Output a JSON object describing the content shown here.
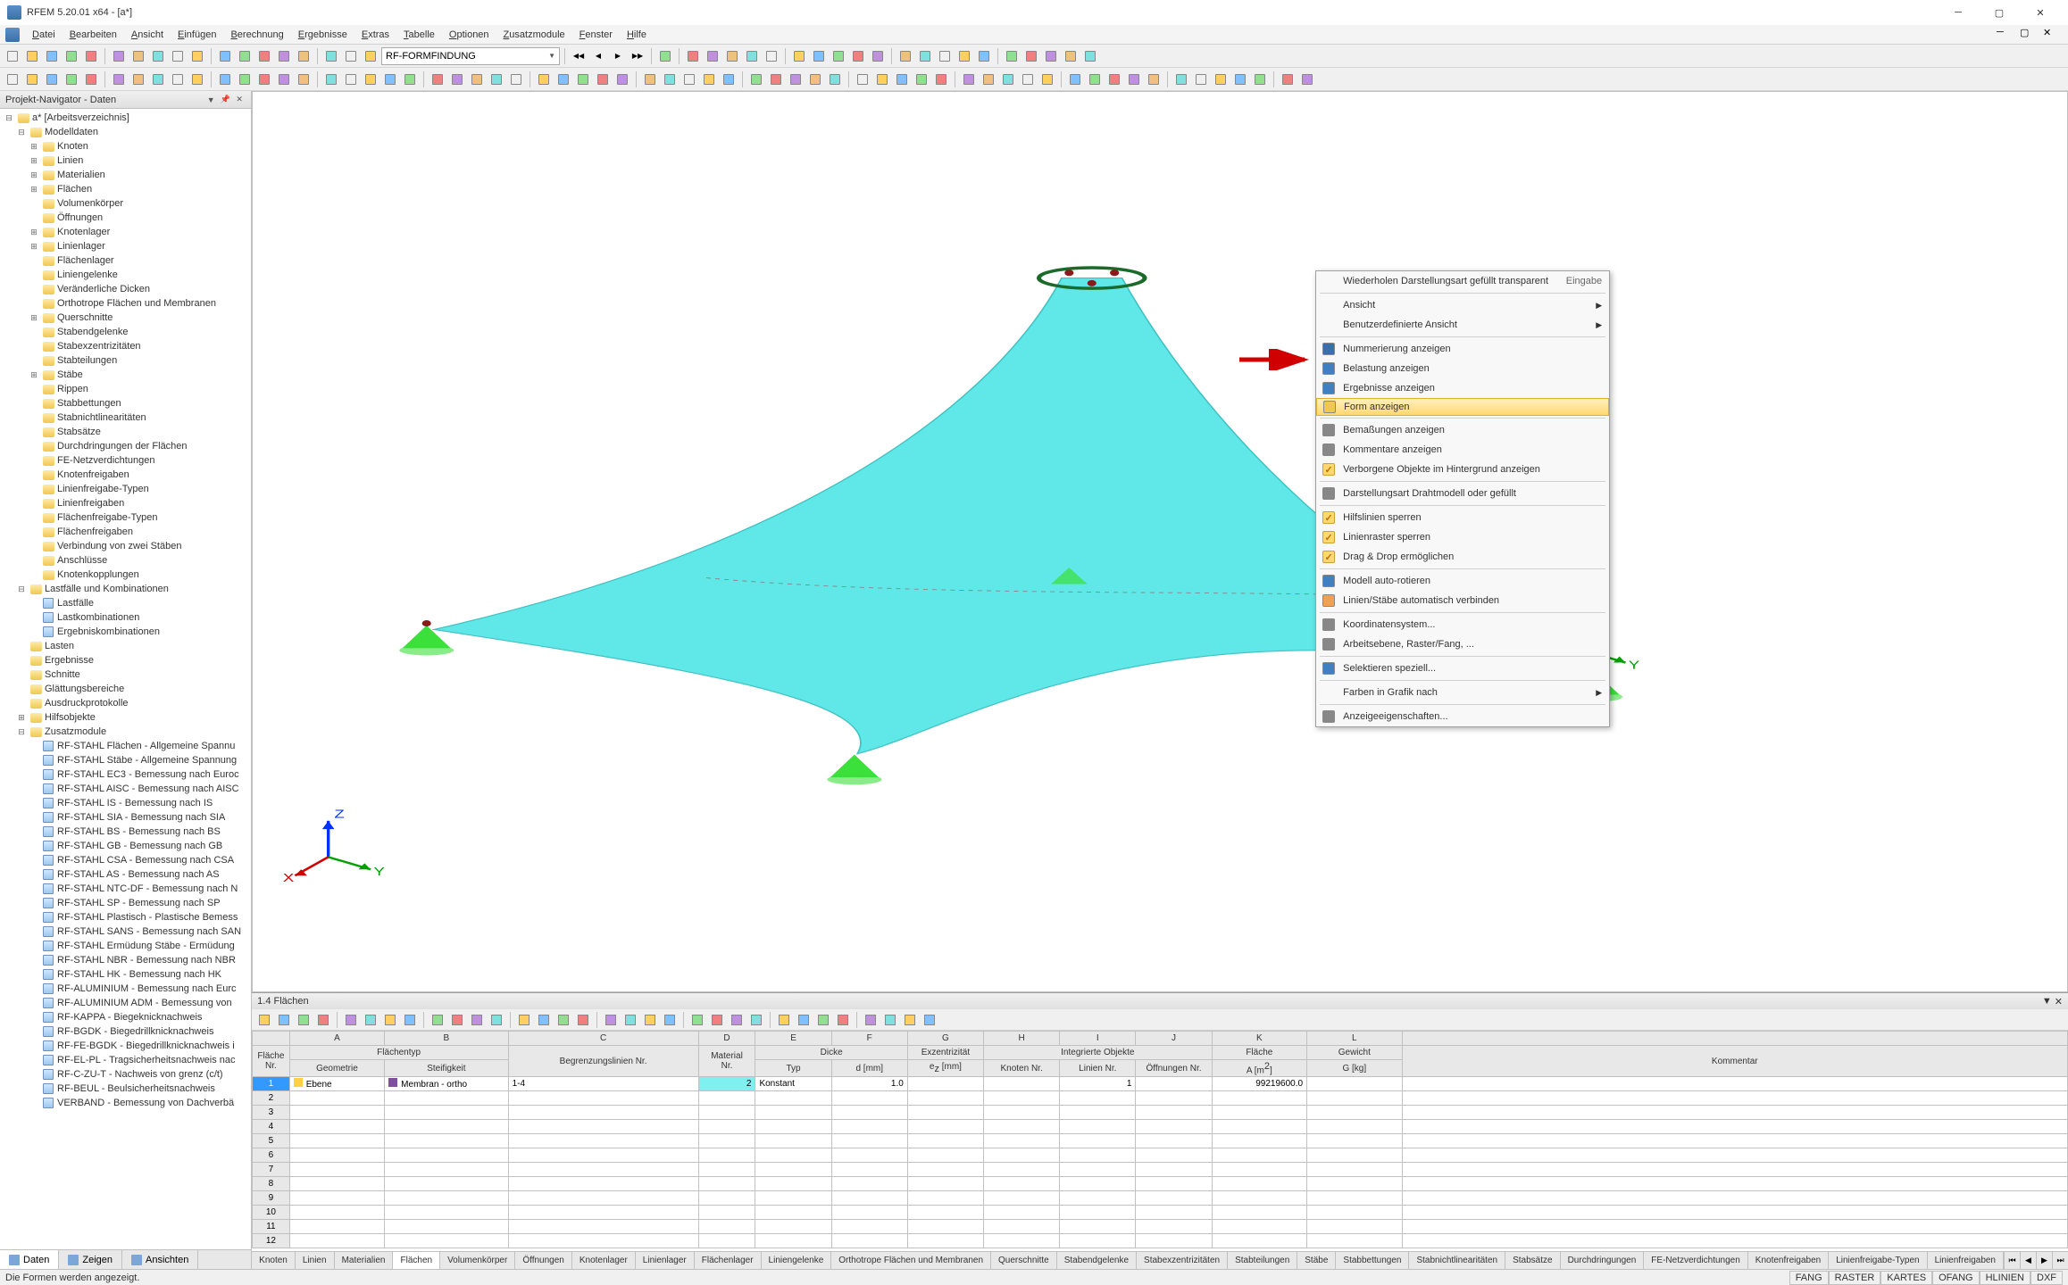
{
  "app": {
    "title": "RFEM 5.20.01 x64 - [a*]"
  },
  "menu": [
    "Datei",
    "Bearbeiten",
    "Ansicht",
    "Einfügen",
    "Berechnung",
    "Ergebnisse",
    "Extras",
    "Tabelle",
    "Optionen",
    "Zusatzmodule",
    "Fenster",
    "Hilfe"
  ],
  "toolbar_combo": "RF-FORMFINDUNG",
  "navigator": {
    "title": "Projekt-Navigator - Daten",
    "root": "a* [Arbeitsverzeichnis]",
    "tabs": [
      "Daten",
      "Zeigen",
      "Ansichten"
    ],
    "modelldaten": {
      "label": "Modelldaten",
      "children": [
        "Knoten",
        "Linien",
        "Materialien",
        "Flächen",
        "Volumenkörper",
        "Öffnungen",
        "Knotenlager",
        "Linienlager",
        "Flächenlager",
        "Liniengelenke",
        "Veränderliche Dicken",
        "Orthotrope Flächen und Membranen",
        "Querschnitte",
        "Stabendgelenke",
        "Stabexzentrizitäten",
        "Stabteilungen",
        "Stäbe",
        "Rippen",
        "Stabbettungen",
        "Stabnichtlinearitäten",
        "Stabsätze",
        "Durchdringungen der Flächen",
        "FE-Netzverdichtungen",
        "Knotenfreigaben",
        "Linienfreigabe-Typen",
        "Linienfreigaben",
        "Flächenfreigabe-Typen",
        "Flächenfreigaben",
        "Verbindung von zwei Stäben",
        "Anschlüsse",
        "Knotenkopplungen"
      ]
    },
    "lastfaelle": {
      "label": "Lastfälle und Kombinationen",
      "children": [
        "Lastfälle",
        "Lastkombinationen",
        "Ergebniskombinationen"
      ]
    },
    "top_level": [
      "Lasten",
      "Ergebnisse",
      "Schnitte",
      "Glättungsbereiche",
      "Ausdruckprotokolle",
      "Hilfsobjekte"
    ],
    "zusatzmodule": {
      "label": "Zusatzmodule",
      "children": [
        "RF-STAHL Flächen - Allgemeine Spannu",
        "RF-STAHL Stäbe - Allgemeine Spannung",
        "RF-STAHL EC3 - Bemessung nach Euroc",
        "RF-STAHL AISC - Bemessung nach AISC",
        "RF-STAHL IS - Bemessung nach IS",
        "RF-STAHL SIA - Bemessung nach SIA",
        "RF-STAHL BS - Bemessung nach BS",
        "RF-STAHL GB - Bemessung nach GB",
        "RF-STAHL CSA - Bemessung nach CSA",
        "RF-STAHL AS - Bemessung nach AS",
        "RF-STAHL NTC-DF - Bemessung nach N",
        "RF-STAHL SP - Bemessung nach SP",
        "RF-STAHL Plastisch - Plastische Bemess",
        "RF-STAHL SANS - Bemessung nach SAN",
        "RF-STAHL Ermüdung Stäbe - Ermüdung",
        "RF-STAHL NBR - Bemessung nach NBR",
        "RF-STAHL HK - Bemessung nach HK",
        "RF-ALUMINIUM - Bemessung nach Eurc",
        "RF-ALUMINIUM ADM - Bemessung von",
        "RF-KAPPA - Biegeknicknachweis",
        "RF-BGDK - Biegedrillknicknachweis",
        "RF-FE-BGDK - Biegedrillknicknachweis i",
        "RF-EL-PL - Tragsicherheitsnachweis nac",
        "RF-C-ZU-T - Nachweis von grenz (c/t)",
        "RF-BEUL - Beulsicherheitsnachweis",
        "VERBAND - Bemessung von Dachverbä"
      ]
    }
  },
  "context_menu": {
    "items": [
      {
        "label": "Wiederholen Darstellungsart gefüllt transparent",
        "shortcut": "Eingabe",
        "icon": ""
      },
      {
        "sep": true
      },
      {
        "label": "Ansicht",
        "sub": true
      },
      {
        "label": "Benutzerdefinierte Ansicht",
        "sub": true
      },
      {
        "sep": true
      },
      {
        "label": "Nummerierung anzeigen",
        "icon": "num",
        "color": "#3a6fa8"
      },
      {
        "label": "Belastung anzeigen",
        "icon": "load",
        "color": "#4080c0"
      },
      {
        "label": "Ergebnisse anzeigen",
        "icon": "res",
        "color": "#4080c0"
      },
      {
        "label": "Form anzeigen",
        "highlighted": true,
        "icon": "form",
        "color": "#f0c850"
      },
      {
        "sep": true
      },
      {
        "label": "Bemaßungen anzeigen",
        "icon": "dim",
        "color": "#888"
      },
      {
        "label": "Kommentare anzeigen",
        "icon": "comm",
        "color": "#888"
      },
      {
        "label": "Verborgene Objekte im Hintergrund anzeigen",
        "icon": "hid",
        "checked": true,
        "color": "#f0c850"
      },
      {
        "sep": true
      },
      {
        "label": "Darstellungsart Drahtmodell oder gefüllt",
        "icon": "wire",
        "color": "#888"
      },
      {
        "sep": true
      },
      {
        "label": "Hilfslinien sperren",
        "icon": "guide",
        "checked": true,
        "color": "#f0c850"
      },
      {
        "label": "Linienraster sperren",
        "icon": "grid",
        "checked": true,
        "color": "#f0c850"
      },
      {
        "label": "Drag & Drop ermöglichen",
        "icon": "drag",
        "checked": true,
        "color": "#f0c850"
      },
      {
        "sep": true
      },
      {
        "label": "Modell auto-rotieren",
        "icon": "rot",
        "color": "#4080c0"
      },
      {
        "label": "Linien/Stäbe automatisch verbinden",
        "icon": "conn",
        "color": "#f0a050"
      },
      {
        "sep": true
      },
      {
        "label": "Koordinatensystem...",
        "icon": "coord",
        "color": "#888"
      },
      {
        "label": "Arbeitsebene, Raster/Fang, ...",
        "icon": "plane",
        "color": "#888"
      },
      {
        "sep": true
      },
      {
        "label": "Selektieren speziell...",
        "icon": "sel",
        "color": "#4080c0"
      },
      {
        "sep": true
      },
      {
        "label": "Farben in Grafik nach",
        "sub": true
      },
      {
        "sep": true
      },
      {
        "label": "Anzeigeeigenschaften...",
        "icon": "disp",
        "color": "#888"
      }
    ]
  },
  "table": {
    "title": "1.4 Flächen",
    "columns_letters": [
      "A",
      "B",
      "C",
      "D",
      "E",
      "F",
      "G",
      "H",
      "I",
      "J",
      "K",
      "L"
    ],
    "header_groups": [
      {
        "label": "Fläche Nr.",
        "span": 0
      },
      {
        "label": "Flächentyp",
        "span": 2
      },
      {
        "label": "Begrenzungslinien Nr.",
        "span": 1
      },
      {
        "label": "Material Nr.",
        "span": 1
      },
      {
        "label": "Dicke",
        "span": 2
      },
      {
        "label": "Exzentrizität",
        "span": 1
      },
      {
        "label": "Integrierte Objekte",
        "span": 3
      },
      {
        "label": "Fläche",
        "span": 1
      },
      {
        "label": "Gewicht",
        "span": 1
      },
      {
        "label": "Kommentar",
        "span": 1
      }
    ],
    "subheaders": [
      "",
      "Geometrie",
      "Steifigkeit",
      "",
      "",
      "Typ",
      "d [mm]",
      "e_z [mm]",
      "Knoten Nr.",
      "Linien Nr.",
      "Öffnungen Nr.",
      "A [m²]",
      "G [kg]",
      ""
    ],
    "row1": {
      "num": "1",
      "geom": "Ebene",
      "geom_color": "#ffd040",
      "steif": "Membran - ortho",
      "steif_color": "#8050a0",
      "begr": "1-4",
      "mat": "2",
      "typ": "Konstant",
      "d": "1.0",
      "ez": "",
      "kn": "",
      "ln": "1",
      "oef": "",
      "a": "99219600.0",
      "g": "",
      "komm": ""
    },
    "tabs": [
      "Knoten",
      "Linien",
      "Materialien",
      "Flächen",
      "Volumenkörper",
      "Öffnungen",
      "Knotenlager",
      "Linienlager",
      "Flächenlager",
      "Liniengelenke",
      "Orthotrope Flächen und Membranen",
      "Querschnitte",
      "Stabendgelenke",
      "Stabexzentrizitäten",
      "Stabteilungen",
      "Stäbe",
      "Stabbettungen",
      "Stabnichtlinearitäten",
      "Stabsätze",
      "Durchdringungen",
      "FE-Netzverdichtungen",
      "Knotenfreigaben",
      "Linienfreigabe-Typen",
      "Linienfreigaben"
    ],
    "active_tab": 3
  },
  "statusbar": {
    "text": "Die Formen werden angezeigt.",
    "items": [
      "FANG",
      "RASTER",
      "KARTES",
      "OFANG",
      "HLINIEN",
      "DXF"
    ]
  }
}
